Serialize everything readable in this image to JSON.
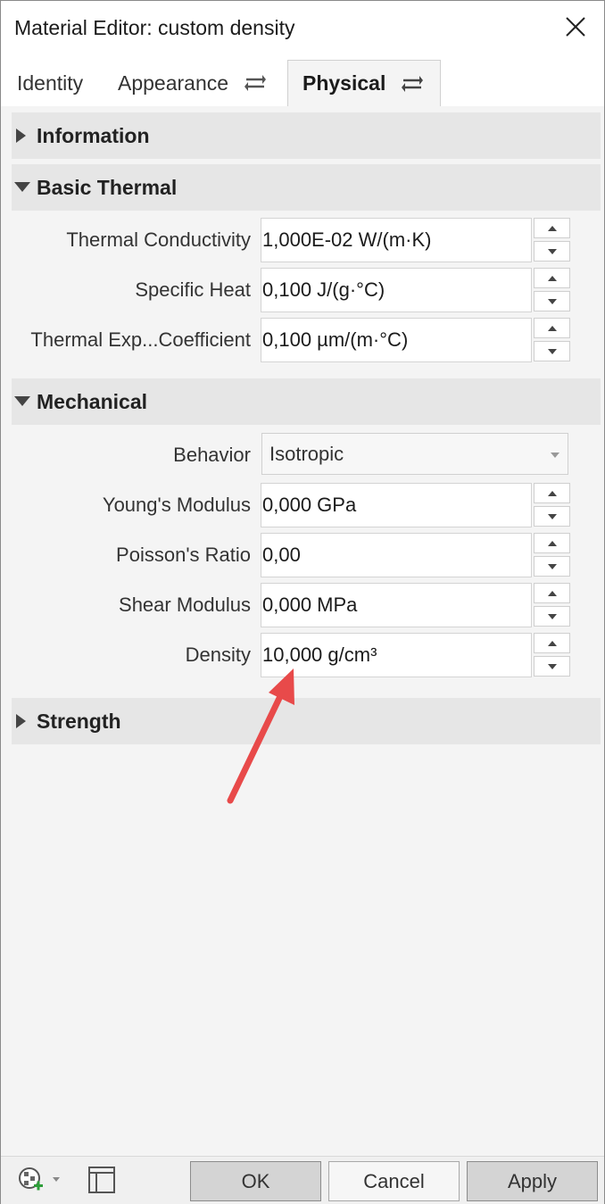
{
  "window": {
    "title": "Material Editor: custom density"
  },
  "tabs": [
    {
      "label": "Identity"
    },
    {
      "label": "Appearance"
    },
    {
      "label": "Physical"
    }
  ],
  "sections": {
    "information": {
      "label": "Information",
      "expanded": false
    },
    "basic_thermal": {
      "label": "Basic Thermal",
      "expanded": true,
      "rows": [
        {
          "label": "Thermal Conductivity",
          "value": "1,000E-02 W/(m·K)"
        },
        {
          "label": "Specific Heat",
          "value": "0,100 J/(g·°C)"
        },
        {
          "label": "Thermal Exp...Coefficient",
          "value": "0,100 µm/(m·°C)"
        }
      ]
    },
    "mechanical": {
      "label": "Mechanical",
      "expanded": true,
      "behavior": {
        "label": "Behavior",
        "value": "Isotropic"
      },
      "rows": [
        {
          "label": "Young's Modulus",
          "value": "0,000 GPa"
        },
        {
          "label": "Poisson's Ratio",
          "value": "0,00"
        },
        {
          "label": "Shear Modulus",
          "value": "0,000 MPa"
        },
        {
          "label": "Density",
          "value": "10,000 g/cm³"
        }
      ]
    },
    "strength": {
      "label": "Strength",
      "expanded": false
    }
  },
  "footer": {
    "ok": "OK",
    "cancel": "Cancel",
    "apply": "Apply"
  },
  "icons": {
    "close": "close-icon",
    "swap": "swap-arrows-icon",
    "expand": "triangle-right-icon",
    "collapse": "triangle-down-icon",
    "add_material": "material-add-icon",
    "panel": "panel-toggle-icon"
  },
  "colors": {
    "annotation_arrow": "#e84a4a",
    "section_bg": "#e6e6e6",
    "add_badge": "#2e9e3a"
  }
}
